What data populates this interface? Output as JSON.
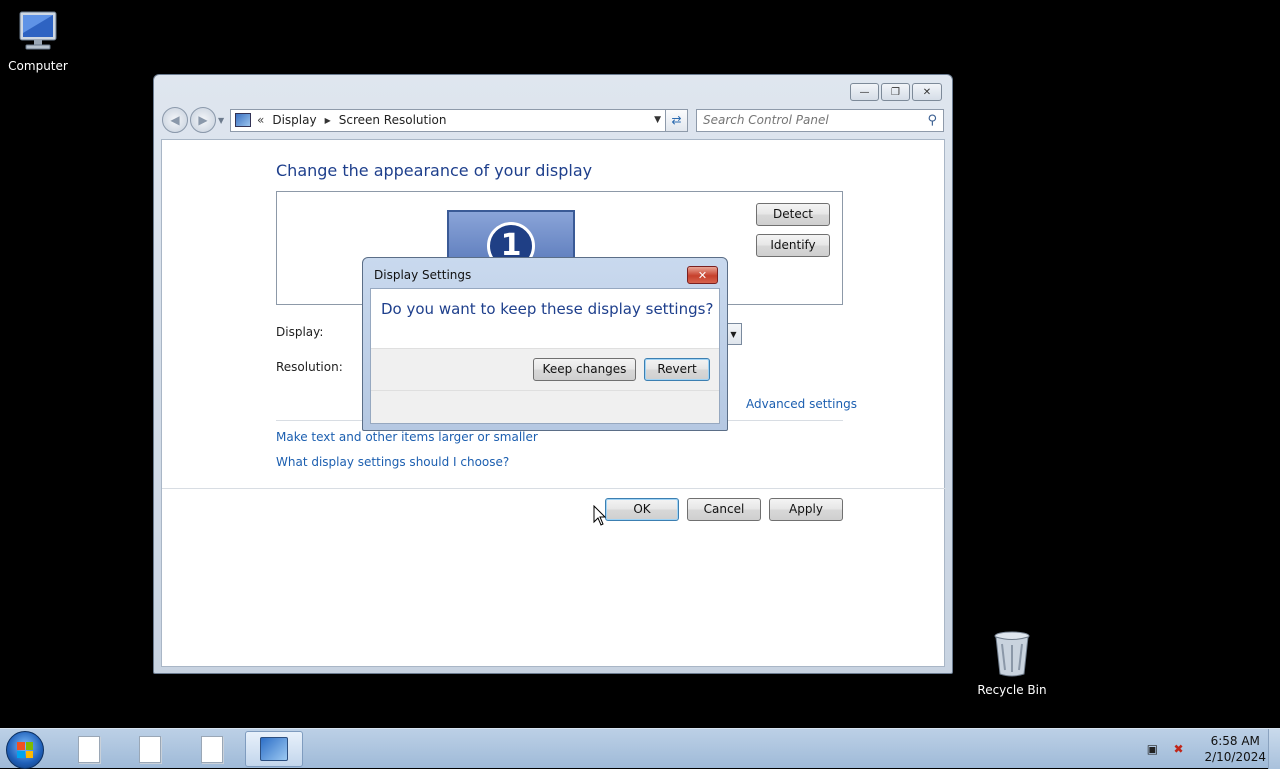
{
  "desktop": {
    "icons": [
      {
        "label": "Computer",
        "icon": "computer-icon"
      },
      {
        "label": "Recycle Bin",
        "icon": "recycle-bin-icon"
      }
    ]
  },
  "window": {
    "address": {
      "overflow": "«",
      "crumbs": [
        "Display",
        "Screen Resolution"
      ]
    },
    "search_placeholder": "Search Control Panel",
    "heading": "Change the appearance of your display",
    "monitor_number": "1",
    "detect_label": "Detect",
    "identify_label": "Identify",
    "display_label": "Display:",
    "resolution_label": "Resolution:",
    "advanced_link": "Advanced settings",
    "link_text_size": "Make text and other items larger or smaller",
    "link_help": "What display settings should I choose?",
    "ok_label": "OK",
    "cancel_label": "Cancel",
    "apply_label": "Apply"
  },
  "dialog": {
    "title": "Display Settings",
    "question": "Do you want to keep these display settings?",
    "keep_label": "Keep changes",
    "revert_label": "Revert"
  },
  "taskbar": {
    "time": "6:58 AM",
    "date": "2/10/2024",
    "items": [
      "document-icon",
      "document-icon",
      "document-icon",
      "control-panel-icon"
    ]
  },
  "colors": {
    "accent_text": "#1e3f8c",
    "link": "#1c5fb0",
    "taskbar": "#bcd0e6"
  }
}
